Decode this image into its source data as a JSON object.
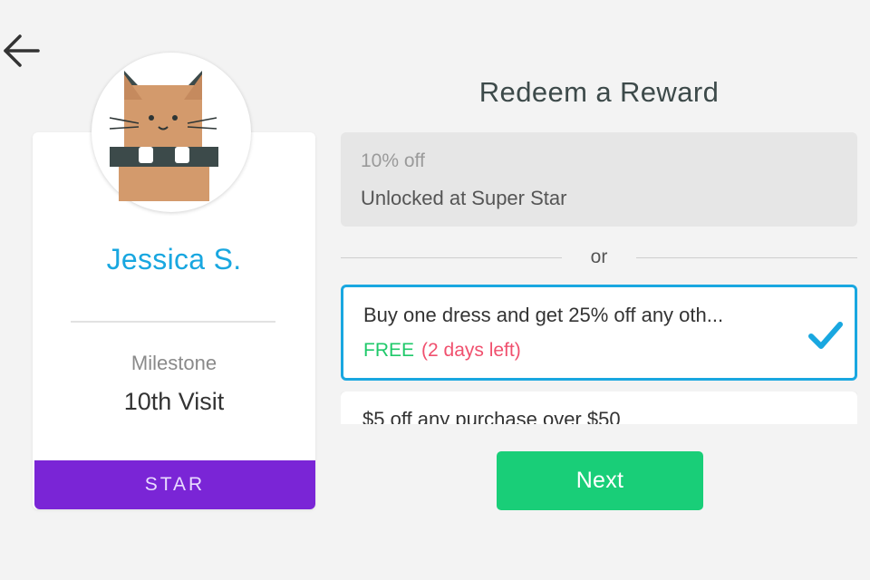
{
  "header": {
    "back_icon": "arrow-left-icon"
  },
  "profile": {
    "avatar_icon": "cat-avatar-icon",
    "name": "Jessica S.",
    "milestone_label": "Milestone",
    "milestone_value": "10th Visit",
    "tier": "STAR",
    "tier_color": "#7a25d6",
    "name_color": "#19a7e0"
  },
  "redeem": {
    "title": "Redeem a Reward",
    "or_label": "or",
    "rewards": [
      {
        "title": "10% off",
        "subtitle": "Unlocked at Super Star",
        "state": "locked"
      },
      {
        "title": "Buy one dress and get 25% off any oth...",
        "price": "FREE",
        "expiry": "(2 days left)",
        "state": "selected",
        "check_icon": "checkmark-icon"
      },
      {
        "title": "$5 off any purchase over $50",
        "state": "available"
      }
    ],
    "next_label": "Next",
    "accent_color": "#19ce78",
    "selected_color": "#19a7e0"
  }
}
